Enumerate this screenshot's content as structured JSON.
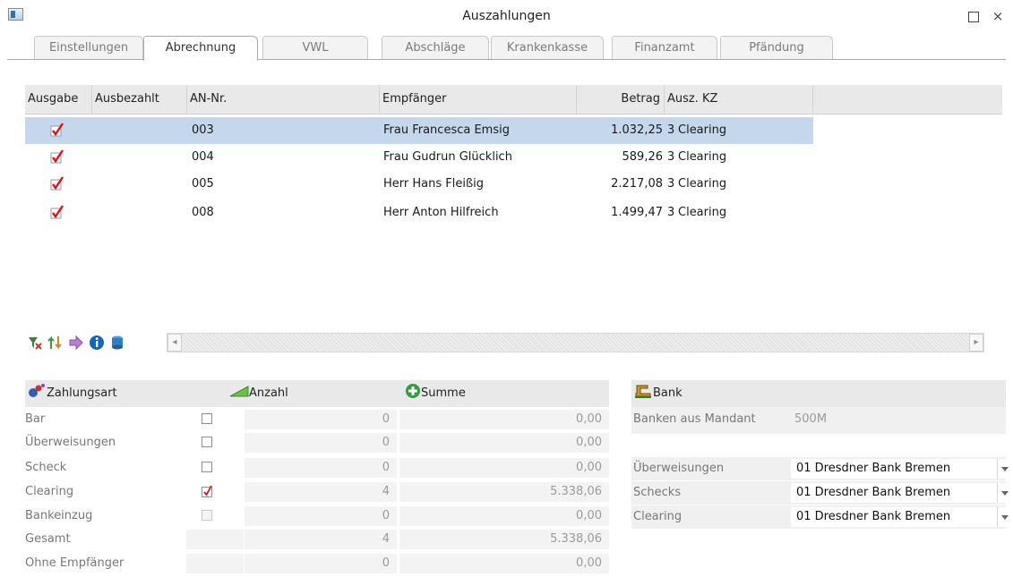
{
  "window": {
    "title": "Auszahlungen",
    "maximize_label": "",
    "close_label": "×"
  },
  "tabs": [
    {
      "label": "Einstellungen",
      "active": false
    },
    {
      "label": "Abrechnung",
      "active": true
    },
    {
      "label": "VWL",
      "active": false
    },
    {
      "label": "Abschläge",
      "active": false
    },
    {
      "label": "Krankenkasse",
      "active": false
    },
    {
      "label": "Finanzamt",
      "active": false
    },
    {
      "label": "Pfändung",
      "active": false
    }
  ],
  "grid": {
    "columns": [
      "Ausgabe",
      "Ausbezahlt",
      "AN-Nr.",
      "Empfänger",
      "Betrag",
      "Ausz. KZ"
    ],
    "rows": [
      {
        "ausgabe": true,
        "an_nr": "003",
        "empfaenger": "Frau Francesca Emsig",
        "betrag": "1.032,25",
        "kz": "3",
        "kz_text": "Clearing",
        "selected": true
      },
      {
        "ausgabe": true,
        "an_nr": "004",
        "empfaenger": "Frau Gudrun Glücklich",
        "betrag": "589,26",
        "kz": "3",
        "kz_text": "Clearing",
        "selected": false
      },
      {
        "ausgabe": true,
        "an_nr": "005",
        "empfaenger": "Herr Hans Fleißig",
        "betrag": "2.217,08",
        "kz": "3",
        "kz_text": "Clearing",
        "selected": false
      },
      {
        "ausgabe": true,
        "an_nr": "008",
        "empfaenger": "Herr Anton Hilfreich",
        "betrag": "1.499,47",
        "kz": "3",
        "kz_text": "Clearing",
        "selected": false
      }
    ],
    "scroll_left": "◂",
    "scroll_right": "▸"
  },
  "payment": {
    "header": {
      "zahlungsart": "Zahlungsart",
      "anzahl": "Anzahl",
      "summe": "Summe"
    },
    "rows": [
      {
        "label": "Bar",
        "checkbox": "unchecked",
        "anzahl": "0",
        "summe": "0,00"
      },
      {
        "label": "Überweisungen",
        "checkbox": "unchecked",
        "anzahl": "0",
        "summe": "0,00"
      },
      {
        "label": "Scheck",
        "checkbox": "unchecked",
        "anzahl": "0",
        "summe": "0,00"
      },
      {
        "label": "Clearing",
        "checkbox": "checked",
        "anzahl": "4",
        "summe": "5.338,06"
      },
      {
        "label": "Bankeinzug",
        "checkbox": "disabled",
        "anzahl": "0",
        "summe": "0,00"
      },
      {
        "label": "Gesamt",
        "checkbox": "none",
        "anzahl": "4",
        "summe": "5.338,06"
      },
      {
        "label": "Ohne Empfänger",
        "checkbox": "none",
        "anzahl": "0",
        "summe": "0,00"
      }
    ]
  },
  "bank": {
    "header": "Bank",
    "mandant_label": "Banken aus Mandant",
    "mandant_value": "500M",
    "rows": [
      {
        "label": "Überweisungen",
        "value": "01  Dresdner Bank Bremen"
      },
      {
        "label": "Schecks",
        "value": "01  Dresdner Bank Bremen"
      },
      {
        "label": "Clearing",
        "value": "01  Dresdner Bank Bremen"
      }
    ]
  },
  "colors": {
    "check_red": "#e0101a",
    "selection": "#c4d7ed",
    "header_bg": "#e9e9e9",
    "cell_grey": "#f3f3f3"
  }
}
